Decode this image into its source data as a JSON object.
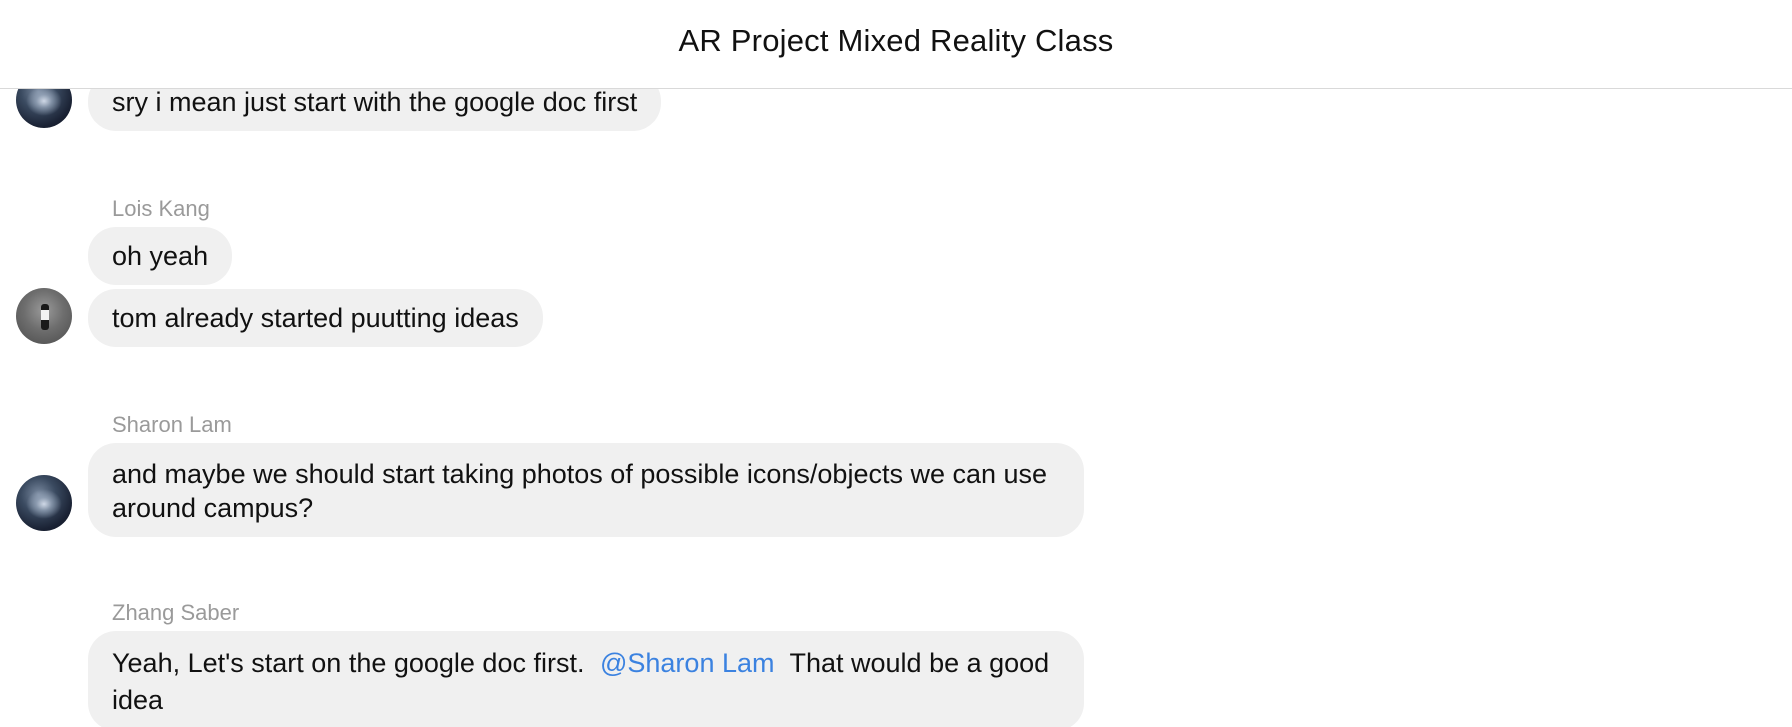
{
  "header": {
    "title": "AR Project Mixed Reality Class"
  },
  "messages": [
    {
      "sender": "",
      "lines": [
        "sry i mean just start with the google doc first"
      ]
    },
    {
      "sender": "Lois Kang",
      "lines": [
        "oh yeah",
        "tom already started puutting ideas"
      ]
    },
    {
      "sender": "Sharon Lam",
      "lines": [
        "and maybe we should start taking photos of possible icons/objects we can use around campus?"
      ]
    },
    {
      "sender": "Zhang Saber",
      "text_before": "Yeah, Let's start on the google doc first.",
      "mention": "@Sharon Lam",
      "text_after": "That would be a good idea"
    }
  ]
}
